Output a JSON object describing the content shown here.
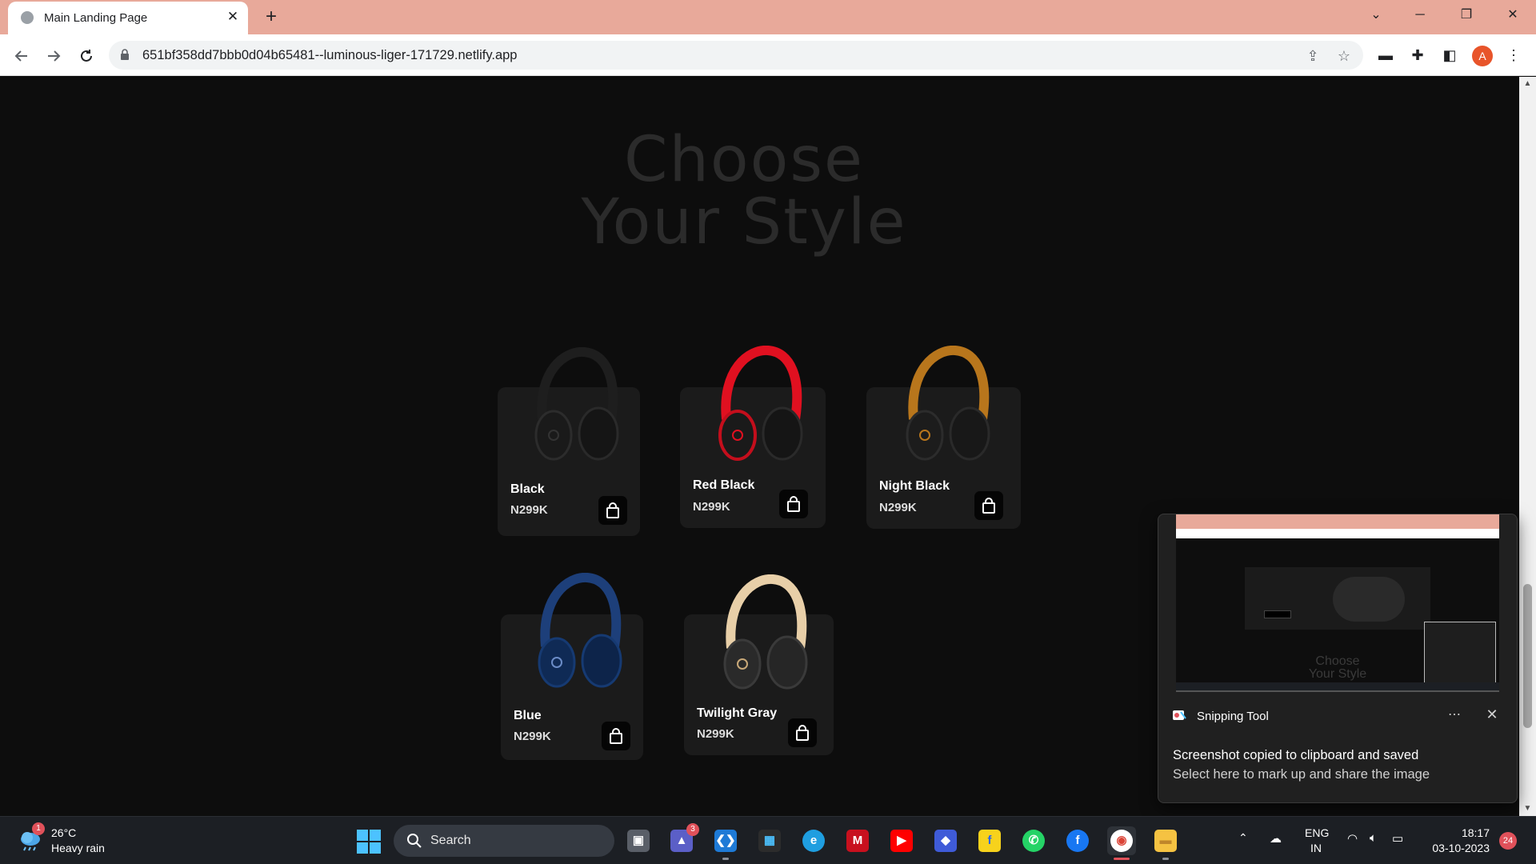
{
  "browser": {
    "tab_title": "Main Landing Page",
    "url": "651bf358dd7bbb0d04b65481--luminous-liger-171729.netlify.app",
    "profile_initial": "A"
  },
  "page": {
    "hero_line1": "Choose",
    "hero_line2": "Your Style",
    "products": [
      {
        "name": "Black",
        "price": "N299K",
        "color": "#1a1a1a",
        "accent": "#2a2a2a"
      },
      {
        "name": "Red Black",
        "price": "N299K",
        "color": "#1a1a1a",
        "accent": "#e01020"
      },
      {
        "name": "Night Black",
        "price": "N299K",
        "color": "#1c1c1c",
        "accent": "#b8761c"
      },
      {
        "name": "Blue",
        "price": "N299K",
        "color": "#0f2a55",
        "accent": "#1d3f7a"
      },
      {
        "name": "Twilight Gray",
        "price": "N299K",
        "color": "#2a2a2a",
        "accent": "#e8cfa8"
      }
    ]
  },
  "toast": {
    "app_name": "Snipping Tool",
    "line1": "Screenshot copied to clipboard and saved",
    "line2": "Select here to mark up and share the image",
    "preview_text_1": "Choose",
    "preview_text_2": "Your Style"
  },
  "taskbar": {
    "weather_badge": "1",
    "temperature": "26°C",
    "condition": "Heavy rain",
    "search_label": "Search",
    "teams_badge": "3",
    "lang_top": "ENG",
    "lang_bottom": "IN",
    "time": "18:17",
    "date": "03-10-2023",
    "notification_count": "24"
  },
  "icons": {
    "back": "arrow-left-icon",
    "forward": "arrow-right-icon",
    "reload": "reload-icon",
    "lock": "lock-icon",
    "share": "share-icon",
    "bookmark": "star-icon",
    "extensions": "puzzle-icon",
    "cart": "shopping-bag-icon"
  }
}
